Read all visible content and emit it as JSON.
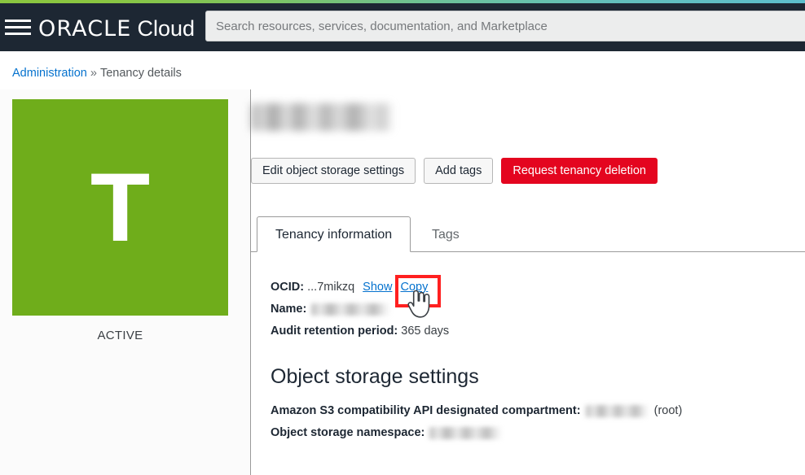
{
  "header": {
    "menu_icon": "hamburger-menu-icon",
    "brand_primary": "ORACLE",
    "brand_secondary": "Cloud",
    "search": {
      "placeholder": "Search resources, services, documentation, and Marketplace",
      "value": ""
    },
    "colors": {
      "background": "#1d2733",
      "gradient_start": "#8ac640",
      "gradient_end": "#5dbecd"
    }
  },
  "breadcrumb": {
    "root_label": "Administration",
    "separator": "»",
    "current_label": "Tenancy details"
  },
  "left_panel": {
    "avatar_letter": "T",
    "avatar_color": "#6fad1b",
    "status": "ACTIVE"
  },
  "main": {
    "page_title": "",
    "page_title_redacted": true,
    "buttons": [
      {
        "label": "Edit object storage settings",
        "style": "secondary"
      },
      {
        "label": "Add tags",
        "style": "secondary"
      },
      {
        "label": "Request tenancy deletion",
        "style": "danger",
        "color": "#e4051f"
      }
    ],
    "tabs": [
      {
        "label": "Tenancy information",
        "active": true
      },
      {
        "label": "Tags",
        "active": false
      }
    ],
    "details": {
      "ocid_label": "OCID:",
      "ocid_value": "...7mikzq",
      "ocid_show_link": "Show",
      "ocid_copy_link": "Copy",
      "name_label": "Name:",
      "name_value_redacted": true,
      "audit_label": "Audit retention period:",
      "audit_value": "365 days"
    },
    "object_storage": {
      "section_title": "Object storage settings",
      "s3_label": "Amazon S3 compatibility API designated compartment:",
      "s3_value_redacted": true,
      "s3_suffix": "(root)",
      "namespace_label": "Object storage namespace:",
      "namespace_value_redacted": true
    },
    "annotation": {
      "highlight_target": "Copy",
      "highlight_color": "#ff2020",
      "cursor": "pointer-hand-cursor"
    }
  }
}
